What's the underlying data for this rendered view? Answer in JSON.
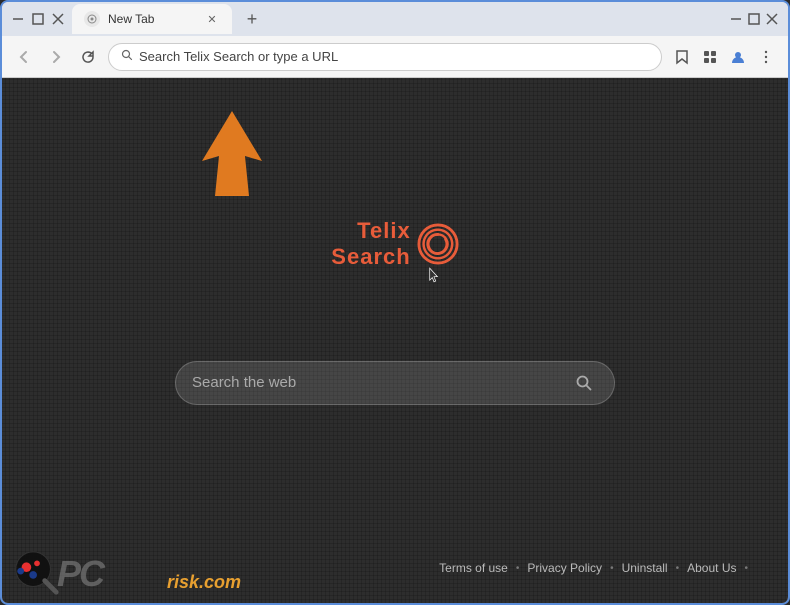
{
  "browser": {
    "title": "New Tab",
    "tab_label": "New Tab",
    "url_placeholder": "Search Telix Search or type a URL",
    "window_controls": {
      "minimize": "—",
      "maximize": "□",
      "close": "✕"
    }
  },
  "logo": {
    "telix": "Telix",
    "search": "Search"
  },
  "search": {
    "placeholder": "Search the web"
  },
  "footer": {
    "terms": "Terms of use",
    "privacy": "Privacy Policy",
    "uninstall": "Uninstall",
    "about": "About Us",
    "dot": "•"
  },
  "pcrisk": {
    "text": "PC",
    "com": "risk.com"
  },
  "colors": {
    "brand_red": "#e85c3a",
    "background": "#2d2d2d",
    "arrow_orange": "#e07a20"
  }
}
